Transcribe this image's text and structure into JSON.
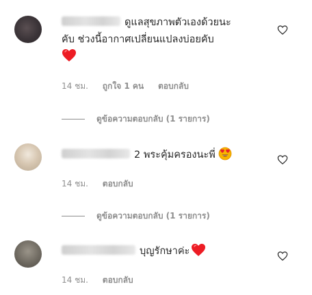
{
  "comments": [
    {
      "text_line1": "ดูแลสุขภาพตัวเองด้วยนะ",
      "text_line2": "คับ ช่วงนี้อากาศเปลี่ยนแปลงบ่อยคับ",
      "emoji": "heart",
      "time": "14 ชม.",
      "likes": "ถูกใจ 1 คน",
      "reply_label": "ตอบกลับ",
      "avatar_color": "#3b3438"
    },
    {
      "text": "2 พระคุ้มครองนะพี่",
      "emoji": "heart-eyes",
      "time": "14 ชม.",
      "reply_label": "ตอบกลับ",
      "avatar_color": "#c9b9a8"
    },
    {
      "text": "บุญรักษาค่ะ",
      "emoji": "heart",
      "time": "14 ชม.",
      "reply_label": "ตอบกลับ",
      "avatar_color": "#6f6a61"
    }
  ],
  "view_replies": [
    "ดูข้อความตอบกลับ (1 รายการ)",
    "ดูข้อความตอบกลับ (1 รายการ)"
  ],
  "colors": {
    "text": "#262626",
    "muted": "#8e8e8e",
    "heart_red": "#ed1c24"
  }
}
